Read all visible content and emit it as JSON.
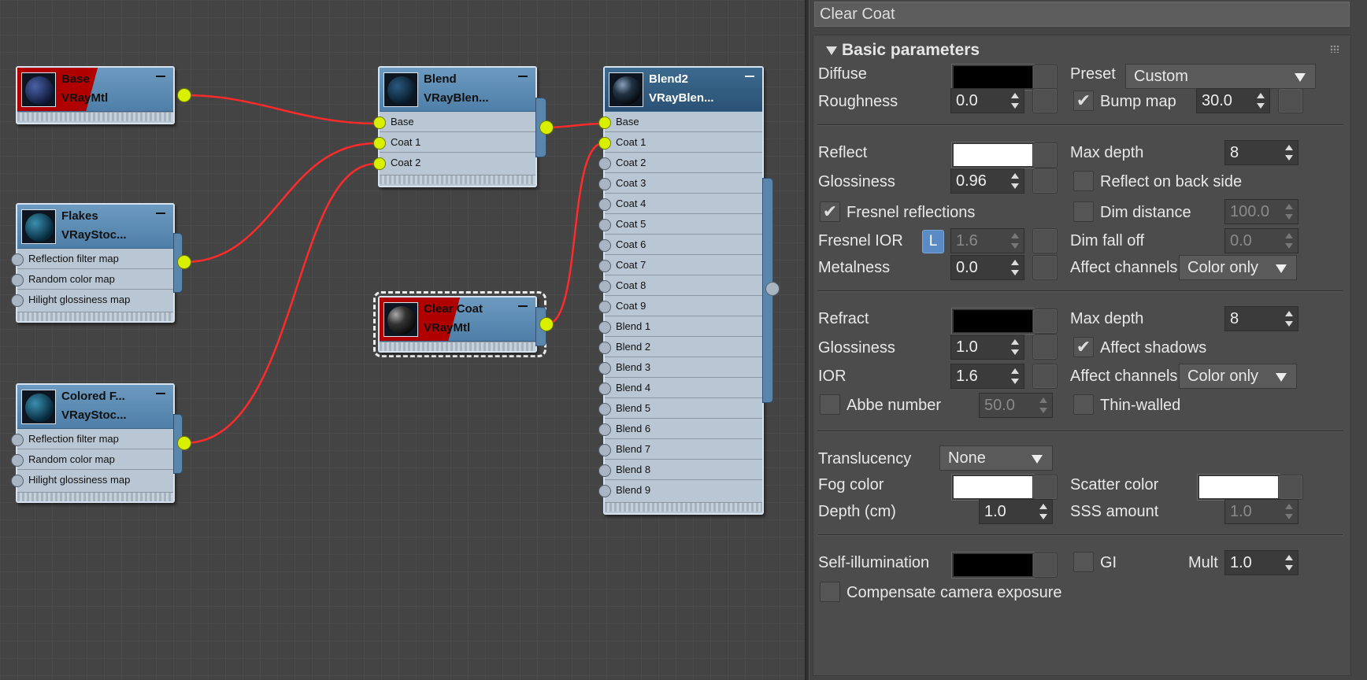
{
  "nodes": {
    "base": {
      "title": "Base",
      "subtitle": "VRayMtl"
    },
    "flakes": {
      "title": "Flakes",
      "subtitle": "VRayStoc...",
      "slots": [
        "Reflection filter map",
        "Random color map",
        "Hilight glossiness map"
      ]
    },
    "colored": {
      "title": "Colored  F...",
      "subtitle": "VRayStoc...",
      "slots": [
        "Reflection filter map",
        "Random color map",
        "Hilight glossiness map"
      ]
    },
    "blend": {
      "title": "Blend",
      "subtitle": "VRayBlen...",
      "slots": [
        "Base",
        "Coat 1",
        "Coat 2"
      ]
    },
    "clearcoat": {
      "title": "Clear Coat",
      "subtitle": "VRayMtl"
    },
    "blend2": {
      "title": "Blend2",
      "subtitle": "VRayBlen...",
      "slots": [
        "Base",
        "Coat 1",
        "Coat 2",
        "Coat 3",
        "Coat 4",
        "Coat 5",
        "Coat 6",
        "Coat 7",
        "Coat 8",
        "Coat 9",
        "Blend 1",
        "Blend 2",
        "Blend 3",
        "Blend 4",
        "Blend 5",
        "Blend 6",
        "Blend 7",
        "Blend 8",
        "Blend 9"
      ]
    }
  },
  "panel": {
    "title": "Clear Coat",
    "rollout": "Basic parameters",
    "diffuse": {
      "label": "Diffuse",
      "color": "#000000"
    },
    "preset": {
      "label": "Preset",
      "value": "Custom"
    },
    "roughness": {
      "label": "Roughness",
      "value": "0.0"
    },
    "bump": {
      "label": "Bump map",
      "value": "30.0",
      "checked": true
    },
    "reflect": {
      "label": "Reflect",
      "color": "#ffffff"
    },
    "refl_max_depth": {
      "label": "Max depth",
      "value": "8"
    },
    "refl_glossiness": {
      "label": "Glossiness",
      "value": "0.96"
    },
    "reflect_back": {
      "label": "Reflect on back side"
    },
    "fresnel": {
      "label": "Fresnel reflections",
      "checked": true
    },
    "dim_distance": {
      "label": "Dim distance",
      "value": "100.0"
    },
    "fresnel_ior": {
      "label": "Fresnel IOR",
      "lock": "L",
      "value": "1.6"
    },
    "dim_falloff": {
      "label": "Dim fall off",
      "value": "0.0"
    },
    "metalness": {
      "label": "Metalness",
      "value": "0.0"
    },
    "refl_affect": {
      "label": "Affect channels",
      "value": "Color only"
    },
    "refract": {
      "label": "Refract",
      "color": "#000000"
    },
    "refr_max_depth": {
      "label": "Max depth",
      "value": "8"
    },
    "refr_glossiness": {
      "label": "Glossiness",
      "value": "1.0"
    },
    "affect_shadows": {
      "label": "Affect shadows",
      "checked": true
    },
    "ior": {
      "label": "IOR",
      "value": "1.6"
    },
    "refr_affect": {
      "label": "Affect channels",
      "value": "Color only"
    },
    "abbe": {
      "label": "Abbe number",
      "value": "50.0"
    },
    "thin": {
      "label": "Thin-walled"
    },
    "translucency": {
      "label": "Translucency",
      "value": "None"
    },
    "fog_color": {
      "label": "Fog color",
      "color": "#ffffff"
    },
    "scatter_color": {
      "label": "Scatter color",
      "color": "#ffffff"
    },
    "depth": {
      "label": "Depth (cm)",
      "value": "1.0"
    },
    "sss": {
      "label": "SSS amount",
      "value": "1.0"
    },
    "self_illum": {
      "label": "Self-illumination",
      "color": "#000000"
    },
    "gi": {
      "label": "GI"
    },
    "mult": {
      "label": "Mult",
      "value": "1.0"
    },
    "compensate": {
      "label": "Compensate camera exposure"
    }
  }
}
